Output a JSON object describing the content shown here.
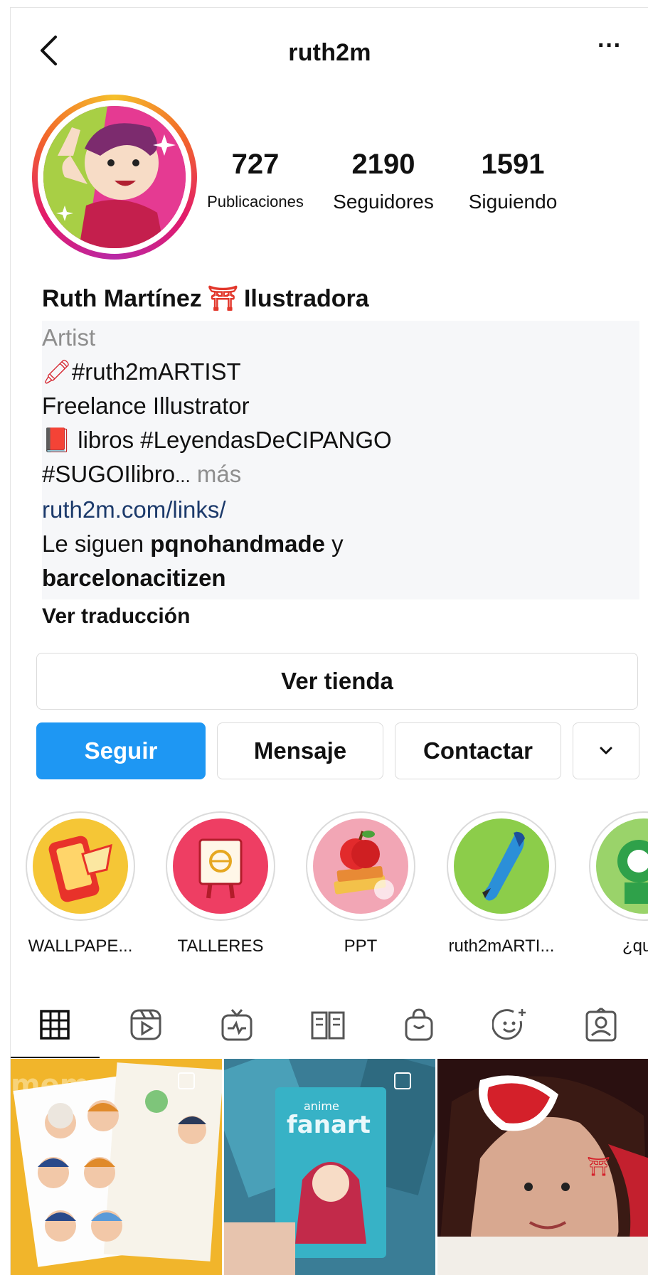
{
  "header": {
    "username": "ruth2m",
    "more_label": "···"
  },
  "stats": [
    {
      "value": "727",
      "label": "Publicaciones"
    },
    {
      "value": "2190",
      "label": "Seguidores"
    },
    {
      "value": "1591",
      "label": "Siguiendo"
    }
  ],
  "bio": {
    "name_before": "Ruth Martínez",
    "name_emoji": "⛩",
    "name_after": "Ilustradora",
    "category": "Artist",
    "line1_emoji": "🖍",
    "line1": "#ruth2mARTIST",
    "line2": "Freelance Illustrator",
    "line3_emoji": "📕",
    "line3": "libros #LeyendasDeCIPANGO",
    "line4": "#SUGOIlibro",
    "line4_ellipsis": "...",
    "more": "más",
    "link": "ruth2m.com/links/",
    "followed_prefix": "Le siguen",
    "followed_user1": "pqnohandmade",
    "followed_and": "y",
    "followed_user2": "barcelonacitizen",
    "see_translation": "Ver traducción"
  },
  "buttons": {
    "shop": "Ver tienda",
    "follow": "Seguir",
    "message": "Mensaje",
    "contact": "Contactar",
    "dropdown": "⌄"
  },
  "highlights": [
    {
      "label": "WALLPAPE...",
      "icon": "phone-icon"
    },
    {
      "label": "TALLERES",
      "icon": "easel-icon"
    },
    {
      "label": "PPT",
      "icon": "apple-books-icon"
    },
    {
      "label": "ruth2mARTI...",
      "icon": "brush-icon"
    },
    {
      "label": "¿quié",
      "icon": "character-icon"
    }
  ],
  "tabs": [
    "grid-icon",
    "reels-icon",
    "igtv-icon",
    "guides-icon",
    "shop-icon",
    "effects-icon",
    "tagged-icon"
  ],
  "grid": {
    "post1_text": "memory",
    "post2_text": "anime fanart"
  },
  "colors": {
    "follow_blue": "#1e97f3",
    "link": "#1c3a6b",
    "secondary_text": "#8e8e8e"
  }
}
